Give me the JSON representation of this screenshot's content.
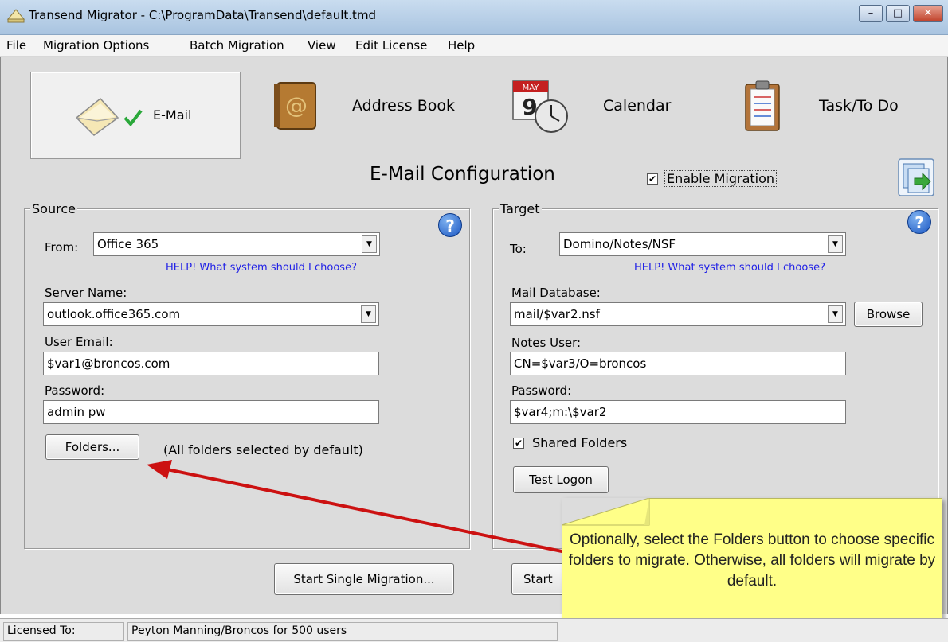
{
  "window": {
    "title": "Transend Migrator - C:\\ProgramData\\Transend\\default.tmd",
    "minimize_glyph": "–",
    "maximize_glyph": "□",
    "close_glyph": "✕"
  },
  "menu": [
    "File",
    "Migration Options",
    "Batch Migration",
    "View",
    "Edit License",
    "Help"
  ],
  "tabs": {
    "email": "E-Mail",
    "address_book": "Address Book",
    "calendar": "Calendar",
    "calendar_month": "MAY",
    "calendar_day": "9",
    "task": "Task/To Do"
  },
  "config": {
    "heading": "E-Mail Configuration",
    "enable_label": "Enable Migration",
    "enable_checked": "✔"
  },
  "source": {
    "legend": "Source",
    "from_label": "From:",
    "from_value": "Office 365",
    "help_link": "HELP! What system should I choose?",
    "server_label": "Server Name:",
    "server_value": "outlook.office365.com",
    "user_label": "User Email:",
    "user_value": "$var1@broncos.com",
    "password_label": "Password:",
    "password_value": "admin pw",
    "folders_button": "Folders...",
    "folders_note": "(All folders selected by default)",
    "start_button": "Start Single Migration..."
  },
  "target": {
    "legend": "Target",
    "to_label": "To:",
    "to_value": "Domino/Notes/NSF",
    "help_link": "HELP! What system should I choose?",
    "db_label": "Mail Database:",
    "db_value": "mail/$var2.nsf",
    "browse_button": "Browse",
    "notes_user_label": "Notes User:",
    "notes_user_value": "CN=$var3/O=broncos",
    "password_label": "Password:",
    "password_value": "$var4;m:\\$var2",
    "shared_label": "Shared Folders",
    "shared_checked": "✔",
    "test_button": "Test Logon",
    "start_button": "Start"
  },
  "help_glyph": "?",
  "callout": {
    "text": "Optionally, select the Folders button to choose specific folders to migrate. Otherwise, all folders will migrate by default."
  },
  "status": {
    "licensed_label": "Licensed To:",
    "licensed_value": "Peyton Manning/Broncos for 500 users"
  },
  "colors": {
    "link": "#1f1fe6",
    "arrow": "#cc1111",
    "callout_bg": "#ffff88",
    "help_blue": "#1a56c2"
  },
  "icons": [
    "app-icon",
    "envelope-icon",
    "checkmark-icon",
    "address-book-icon",
    "calendar-clock-icon",
    "task-clipboard-icon",
    "help-icon",
    "run-export-icon",
    "dropdown-arrow-icon"
  ]
}
